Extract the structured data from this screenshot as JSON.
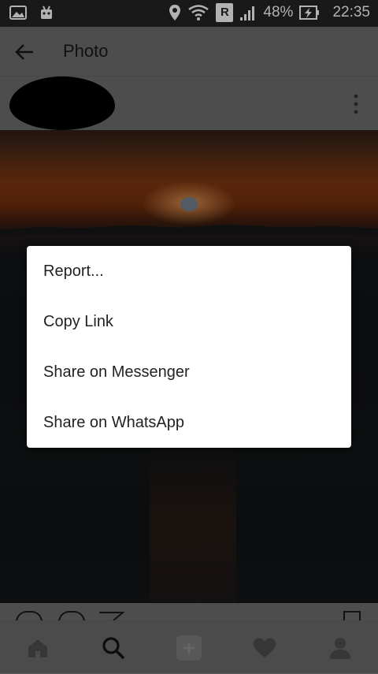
{
  "status_bar": {
    "battery_percent": "48%",
    "time": "22:35",
    "network_label": "R",
    "icons": [
      "gallery-icon",
      "android-icon",
      "location-icon",
      "wifi-icon",
      "roaming-icon",
      "signal-icon",
      "battery-charging-icon"
    ]
  },
  "app_bar": {
    "title": "Photo",
    "back_icon": "arrow-left-icon"
  },
  "post": {
    "more_icon": "more-vert-icon"
  },
  "dialog": {
    "items": [
      {
        "label": "Report..."
      },
      {
        "label": "Copy Link"
      },
      {
        "label": "Share on Messenger"
      },
      {
        "label": "Share on WhatsApp"
      }
    ]
  },
  "bottom_nav": {
    "items": [
      {
        "icon": "home-icon"
      },
      {
        "icon": "search-icon"
      },
      {
        "icon": "add-icon"
      },
      {
        "icon": "heart-icon"
      },
      {
        "icon": "profile-icon"
      }
    ]
  },
  "colors": {
    "dialog_bg": "#ffffff",
    "appbar_bg": "#5f5f5f",
    "text_dark": "#141414"
  }
}
